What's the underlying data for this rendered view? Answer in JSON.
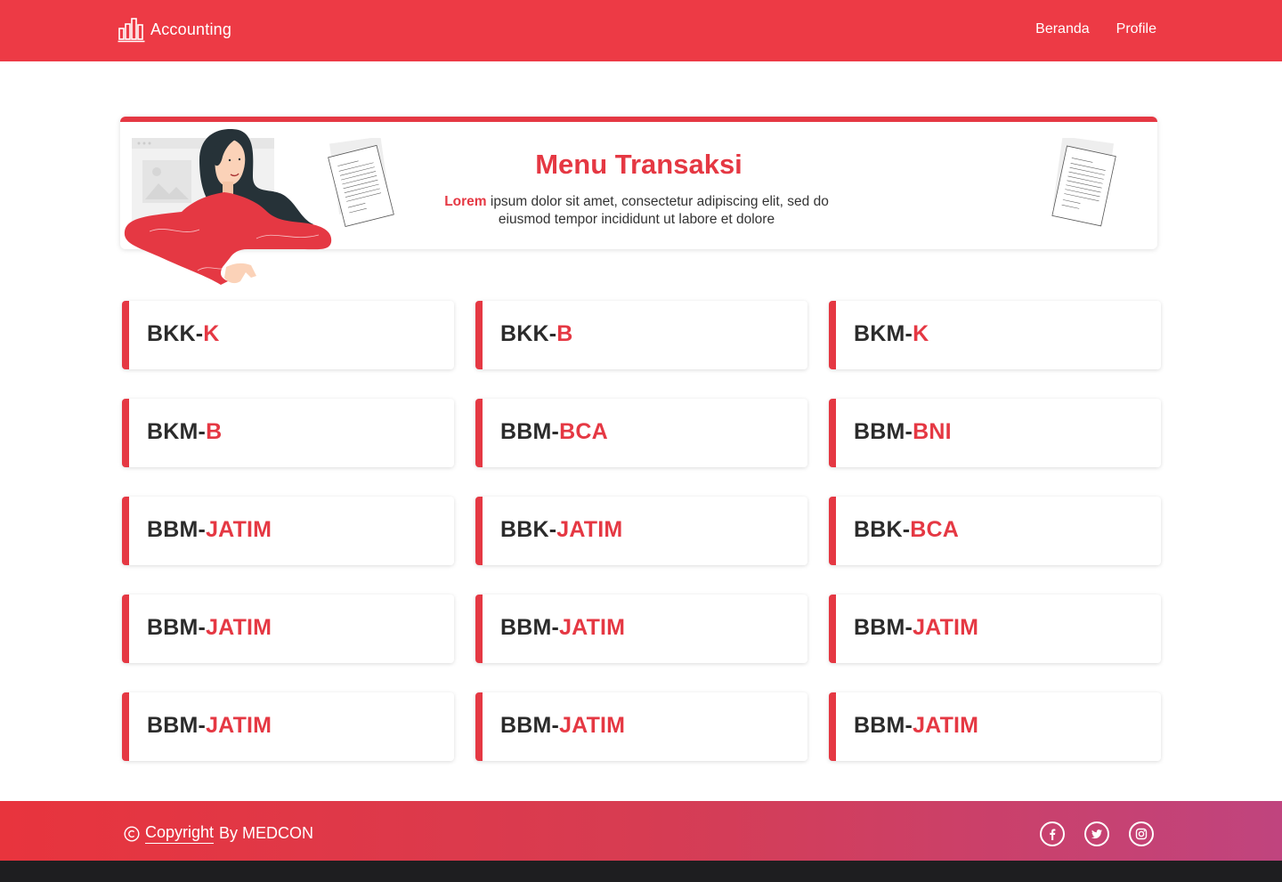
{
  "header": {
    "brand": "Accounting",
    "nav": [
      "Beranda",
      "Profile"
    ]
  },
  "banner": {
    "title": "Menu Transaksi",
    "desc_lead": "Lorem",
    "desc_rest": " ipsum dolor sit amet, consectetur adipiscing elit, sed do eiusmod tempor incididunt ut labore et dolore"
  },
  "cards": [
    {
      "prefix": "BKK-",
      "suffix": "K"
    },
    {
      "prefix": "BKK-",
      "suffix": "B"
    },
    {
      "prefix": "BKM-",
      "suffix": "K"
    },
    {
      "prefix": "BKM-",
      "suffix": "B"
    },
    {
      "prefix": "BBM-",
      "suffix": "BCA"
    },
    {
      "prefix": "BBM-",
      "suffix": "BNI"
    },
    {
      "prefix": "BBM-",
      "suffix": "JATIM"
    },
    {
      "prefix": "BBK-",
      "suffix": "JATIM"
    },
    {
      "prefix": "BBK-",
      "suffix": "BCA"
    },
    {
      "prefix": "BBM-",
      "suffix": "JATIM"
    },
    {
      "prefix": "BBM-",
      "suffix": "JATIM"
    },
    {
      "prefix": "BBM-",
      "suffix": "JATIM"
    },
    {
      "prefix": "BBM-",
      "suffix": "JATIM"
    },
    {
      "prefix": "BBM-",
      "suffix": "JATIM"
    },
    {
      "prefix": "BBM-",
      "suffix": "JATIM"
    }
  ],
  "footer": {
    "copyright_link": "Copyright",
    "copyright_rest": "By MEDCON",
    "socials": [
      "facebook-icon",
      "twitter-icon",
      "instagram-icon"
    ]
  },
  "colors": {
    "primary": "#ED3A45",
    "accent": "#E53843",
    "text": "#2b2b2b",
    "footer_end": "#C0447E"
  }
}
